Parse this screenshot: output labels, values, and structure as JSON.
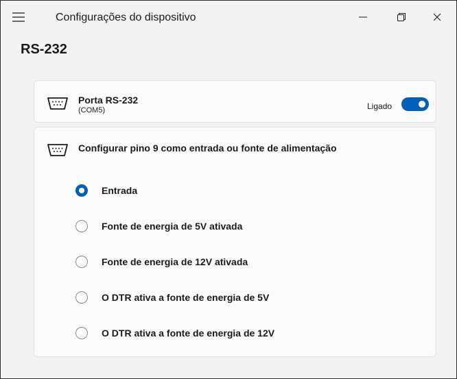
{
  "window": {
    "title": "Configurações do dispositivo",
    "icons": {
      "menu": "hamburger-icon",
      "minimize": "minimize-icon",
      "maximize": "restore-icon",
      "close": "close-icon"
    }
  },
  "page": {
    "title": "RS-232"
  },
  "port": {
    "icon": "serial-port-icon",
    "name": "Porta RS-232",
    "sub": "(COM5)",
    "toggle_label": "Ligado",
    "toggle_on": true
  },
  "config": {
    "icon": "serial-port-icon",
    "heading": "Configurar pino 9 como entrada ou fonte de alimentação",
    "options": [
      {
        "label": "Entrada",
        "selected": true
      },
      {
        "label": "Fonte de energia de 5V ativada",
        "selected": false
      },
      {
        "label": "Fonte de energia de 12V ativada",
        "selected": false
      },
      {
        "label": "O DTR ativa a fonte de energia de 5V",
        "selected": false
      },
      {
        "label": "O DTR ativa a fonte de energia de 12V",
        "selected": false
      }
    ]
  },
  "colors": {
    "accent": "#005fb8",
    "background": "#f3f3f3",
    "card": "#fbfbfb"
  }
}
